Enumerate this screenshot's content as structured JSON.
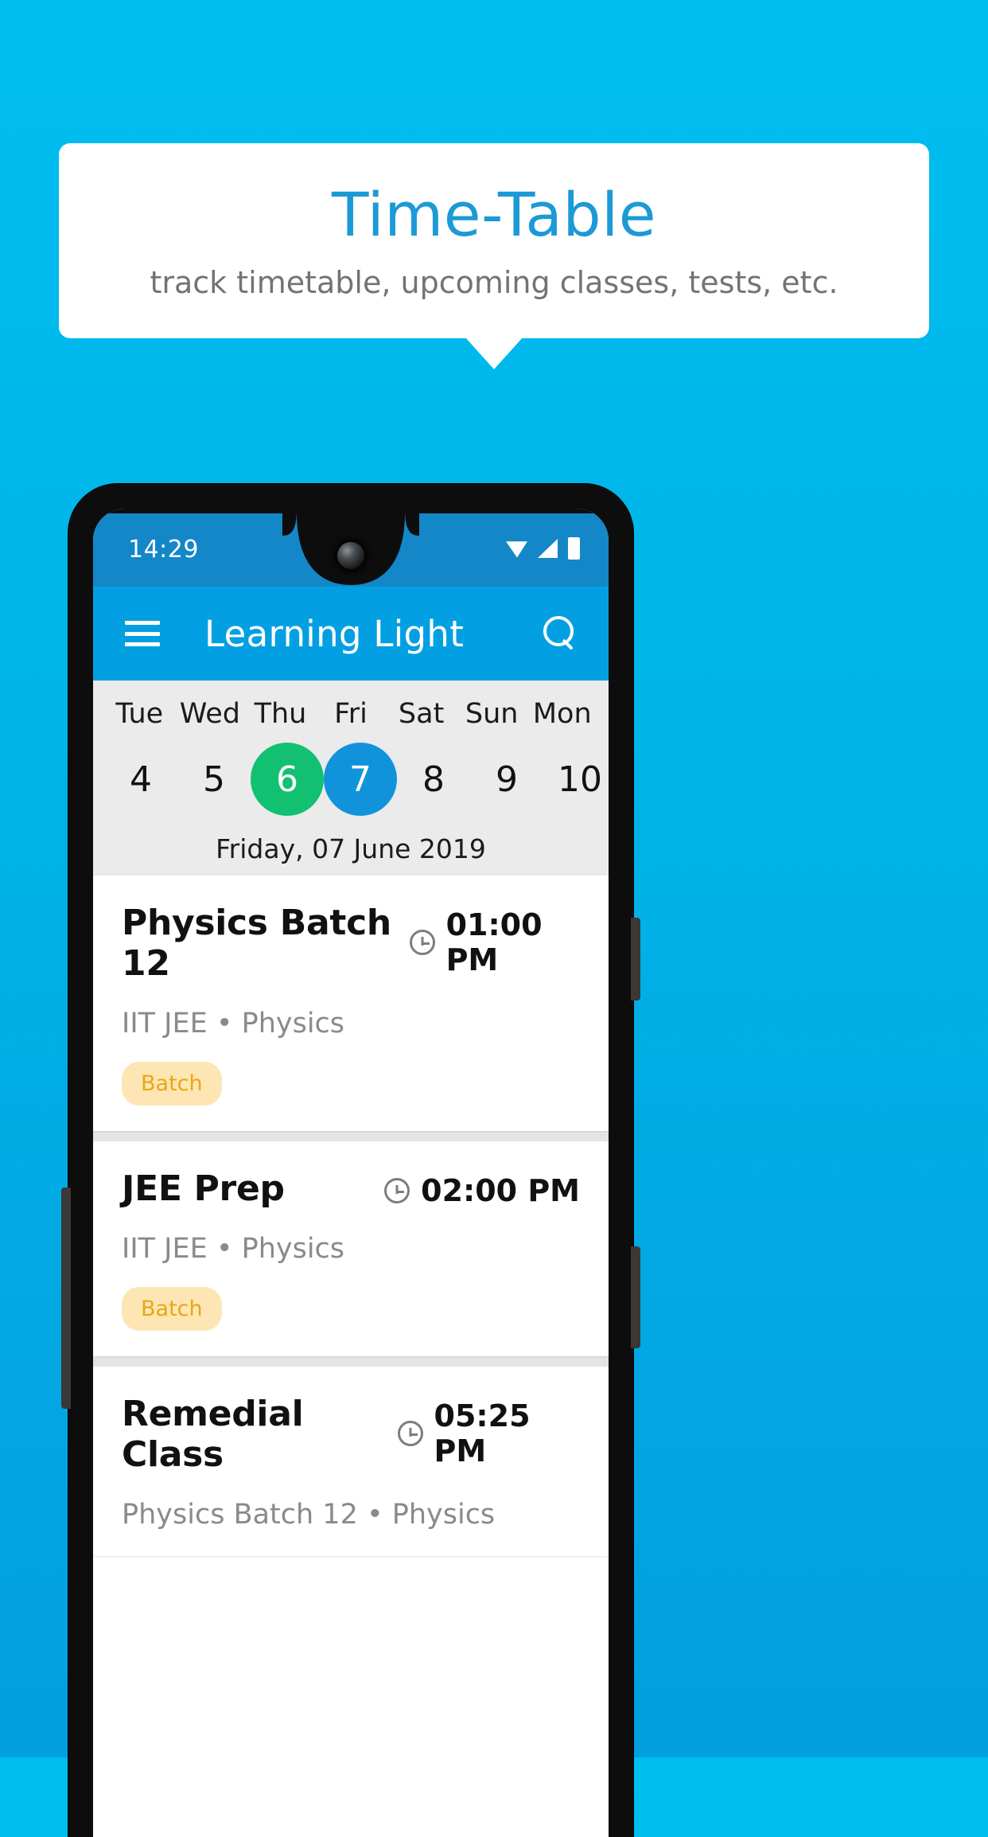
{
  "promo": {
    "title": "Time-Table",
    "subtitle": "track timetable, upcoming classes, tests, etc.",
    "title_color": "#1C9AD6",
    "subtitle_color": "#737373"
  },
  "background": {
    "gradient_top": "#00BEF0",
    "gradient_bottom": "#039FE0"
  },
  "phone": {
    "status_bar": {
      "time": "14:29",
      "background": "#1387C8",
      "icons": [
        "wifi-icon",
        "signal-icon",
        "battery-icon"
      ]
    },
    "app_bar": {
      "title": "Learning Light",
      "background": "#02A0E2",
      "menu_icon": "hamburger-menu-icon",
      "search_icon": "search-icon"
    },
    "calendar": {
      "background": "#EBEBEB",
      "today_color": "#12C072",
      "selected_color": "#1193DC",
      "days": [
        {
          "weekday": "Tue",
          "date": "4",
          "state": "normal"
        },
        {
          "weekday": "Wed",
          "date": "5",
          "state": "normal"
        },
        {
          "weekday": "Thu",
          "date": "6",
          "state": "today"
        },
        {
          "weekday": "Fri",
          "date": "7",
          "state": "selected"
        },
        {
          "weekday": "Sat",
          "date": "8",
          "state": "normal"
        },
        {
          "weekday": "Sun",
          "date": "9",
          "state": "normal"
        },
        {
          "weekday": "Mon",
          "date": "10",
          "state": "normal"
        }
      ],
      "selected_date_label": "Friday, 07 June 2019"
    },
    "classes": [
      {
        "title": "Physics Batch 12",
        "time": "01:00 PM",
        "subtitle": "IIT JEE • Physics",
        "badge": "Batch"
      },
      {
        "title": "JEE Prep",
        "time": "02:00 PM",
        "subtitle": "IIT JEE • Physics",
        "badge": "Batch"
      },
      {
        "title": "Remedial Class",
        "time": "05:25 PM",
        "subtitle": "Physics Batch 12 • Physics",
        "badge": ""
      }
    ],
    "badge_colors": {
      "background": "#FDE6B4",
      "text": "#E9A712"
    }
  }
}
